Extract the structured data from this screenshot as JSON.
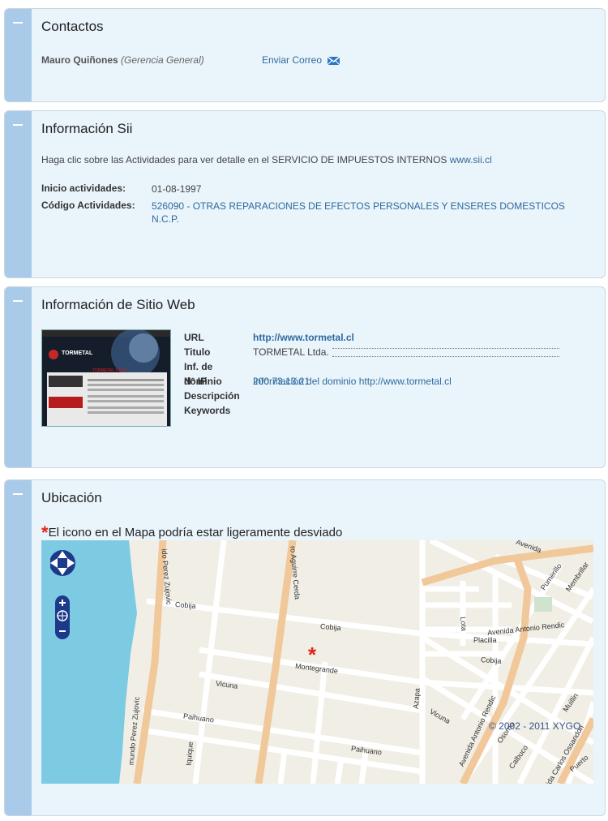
{
  "contactos": {
    "title": "Contactos",
    "name": "Mauro Quiñones",
    "role": "(Gerencia General)",
    "email_link": "Enviar Correo",
    "email_icon": "envelope-icon"
  },
  "sii": {
    "title": "Información Sii",
    "intro_text": "Haga clic sobre las Actividades para ver detalle en el SERVICIO DE IMPUESTOS INTERNOS",
    "intro_link": "www.sii.cl",
    "inicio_label": "Inicio actividades:",
    "inicio_value": "01-08-1997",
    "codigo_label": "Código Actividades:",
    "codigo_value": "526090 - OTRAS REPARACIONES DE EFECTOS PERSONALES Y ENSERES DOMESTICOS N.C.P."
  },
  "web": {
    "title": "Información de Sitio Web",
    "url_label": "URL",
    "url_value": "http://www.tormetal.cl",
    "titulo_label": "Titulo",
    "titulo_value": "TORMETAL Ltda.",
    "dominio_label": "Inf. de dominio",
    "dominio_value": "Información del dominio http://www.tormetal.cl",
    "ip_label": "N° IP",
    "ip_value": "200.73.13.21",
    "descripcion_label": "Descripción",
    "keywords_label": "Keywords",
    "thumb_logo": "TORMETAL",
    "thumb_heading": "TORMETAL LTDA."
  },
  "ubicacion": {
    "title": "Ubicación",
    "note": "El icono en el Mapa podría estar ligeramente desviado",
    "copyright": "© 2002 - 2011 XYGO",
    "streets": {
      "cobija": "Cobija",
      "cobija2": "Cobija",
      "cobija3": "Cobija",
      "montegrande": "Montegrande",
      "vicuna": "Vicuna",
      "vicuna2": "Vicuna",
      "paihuano": "Paihuano",
      "paihuano2": "Paihuano",
      "placilla": "Placilla",
      "rendic": "Avenida Antonio Rendic",
      "rendic2": "Avenida Antonio Rendic",
      "zujovic": "ido Perez Zujovic",
      "zujovic2": "mundo Perez Zujovic",
      "aguirre": "ro Aguirre Cerda",
      "azapa": "Azapa",
      "iquique": "Iquique",
      "avenida": "Avenida",
      "pumerillo": "Pumerillo",
      "membrillar": "Membrillar",
      "muillin": "Muillin",
      "osorno": "Osorno",
      "calbuco": "Calbuco",
      "ossandon": "nida Carlos Ossandon",
      "puerto": "Puerto",
      "lota": "Lota"
    }
  },
  "colors": {
    "panel_bg": "#eaf4fb",
    "side_bar": "#a9cbe9",
    "link": "#2f6a9e",
    "marker": "#e2231a",
    "sea": "#7ccbe3",
    "main_road": "#f0c89a"
  }
}
